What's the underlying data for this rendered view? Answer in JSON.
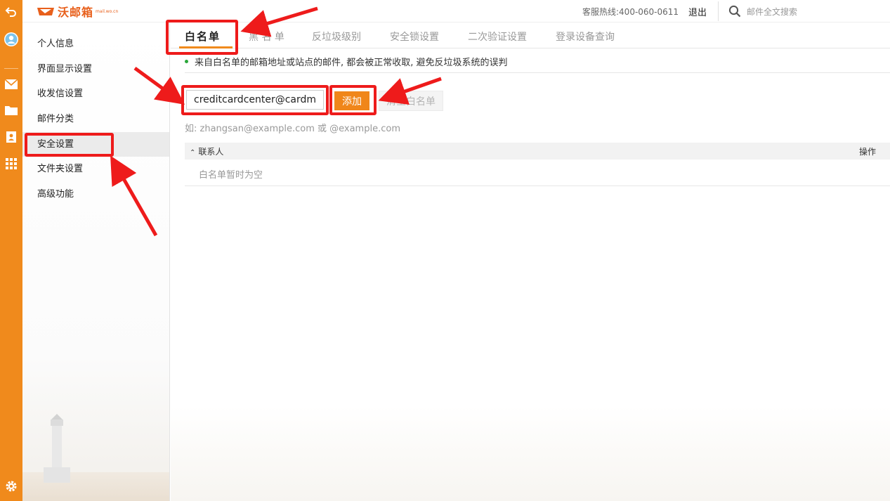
{
  "header": {
    "logo_text": "沃邮箱",
    "logo_sub": "mail.wo.cn",
    "hotline": "客服热线:400-060-0611",
    "logout": "退出",
    "search_placeholder": "邮件全文搜索"
  },
  "sidebar": {
    "items": [
      {
        "label": "个人信息"
      },
      {
        "label": "界面显示设置"
      },
      {
        "label": "收发信设置"
      },
      {
        "label": "邮件分类"
      },
      {
        "label": "安全设置",
        "active": true
      },
      {
        "label": "文件夹设置"
      },
      {
        "label": "高级功能"
      }
    ]
  },
  "tabs": [
    {
      "label": "白名单",
      "active": true
    },
    {
      "label": "黑 名 单"
    },
    {
      "label": "反垃圾级别"
    },
    {
      "label": "安全锁设置"
    },
    {
      "label": "二次验证设置"
    },
    {
      "label": "登录设备查询"
    }
  ],
  "whitelist": {
    "notice": "来自白名单的邮箱地址或站点的邮件, 都会被正常收取, 避免反垃圾系统的误判",
    "input_value": "creditcardcenter@cardmail.",
    "add_label": "添加",
    "clear_label": "清空白名单",
    "hint": "如: zhangsan@example.com 或 @example.com",
    "col_contact": "联系人",
    "col_action": "操作",
    "empty_text": "白名单暂时为空"
  },
  "colors": {
    "accent": "#f08a1c",
    "annotation": "#ee1b1b",
    "notice_dot": "#2aa73a"
  }
}
